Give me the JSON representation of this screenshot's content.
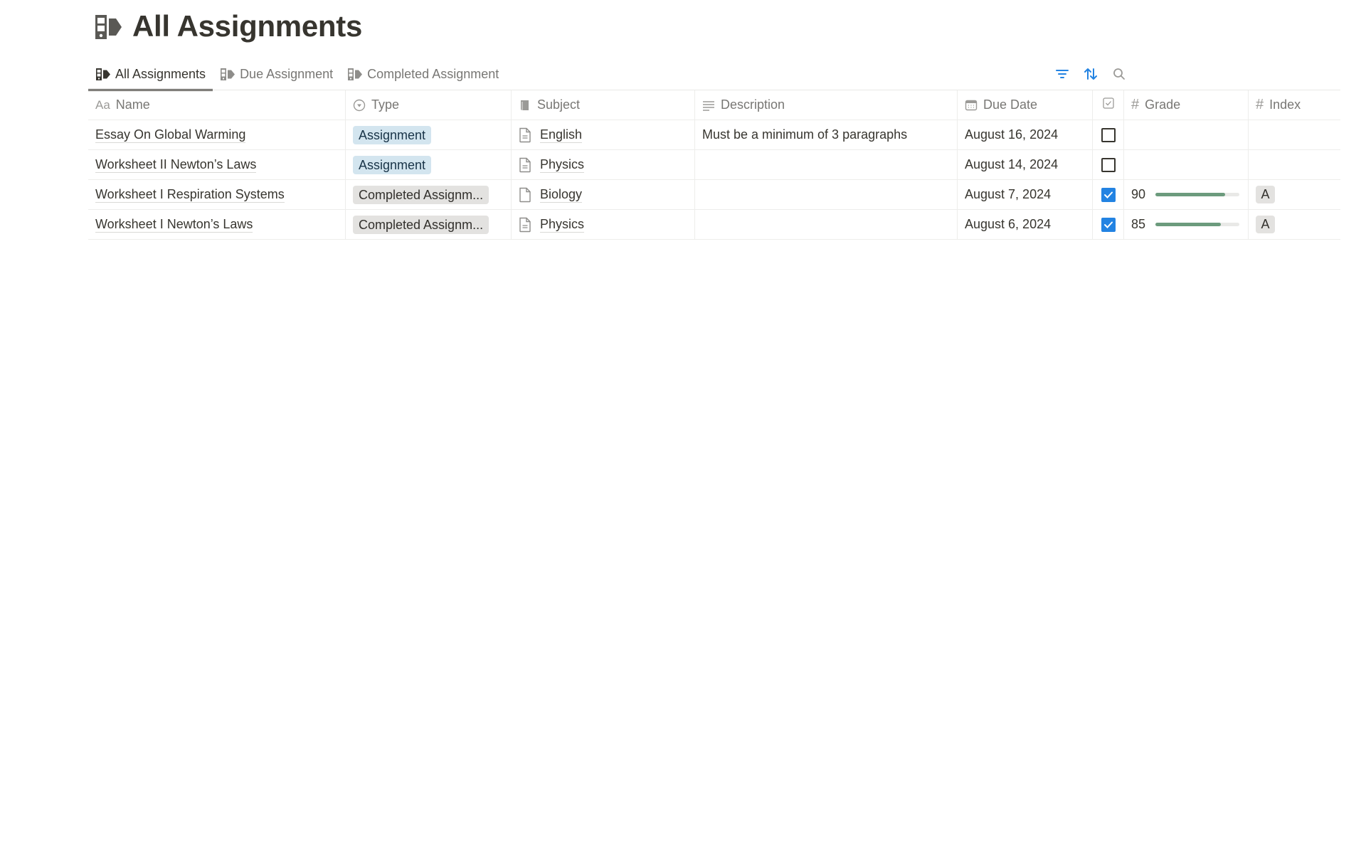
{
  "page": {
    "title": "All Assignments",
    "icon": "assignment-icon"
  },
  "tabs": [
    {
      "label": "All Assignments",
      "active": true
    },
    {
      "label": "Due Assignment",
      "active": false
    },
    {
      "label": "Completed Assignment",
      "active": false
    }
  ],
  "toolbar": {
    "filter_icon": "filter-icon",
    "sort_icon": "sort-icon",
    "search_icon": "search-icon",
    "accent": "#2383e2"
  },
  "table": {
    "columns": [
      {
        "key": "name",
        "label": "Name",
        "icon": "text-icon",
        "icon_text": "Aa"
      },
      {
        "key": "type",
        "label": "Type",
        "icon": "select-icon"
      },
      {
        "key": "subject",
        "label": "Subject",
        "icon": "relation-icon"
      },
      {
        "key": "description",
        "label": "Description",
        "icon": "text-lines-icon"
      },
      {
        "key": "due_date",
        "label": "Due Date",
        "icon": "calendar-icon"
      },
      {
        "key": "done",
        "label": "",
        "icon": "checkbox-icon"
      },
      {
        "key": "grade",
        "label": "Grade",
        "icon": "number-icon"
      },
      {
        "key": "index",
        "label": "Index",
        "icon": "number-icon"
      }
    ],
    "rows": [
      {
        "name": "Essay On Global Warming",
        "type": "Assignment",
        "type_color": "blue",
        "subject": "English",
        "description": "Must be a minimum of 3 paragraphs",
        "due_date": "August 16, 2024",
        "done": false,
        "grade": "",
        "grade_percent": null,
        "index": ""
      },
      {
        "name": "Worksheet II Newton’s Laws",
        "type": "Assignment",
        "type_color": "blue",
        "subject": "Physics",
        "description": "",
        "due_date": "August 14, 2024",
        "done": false,
        "grade": "",
        "grade_percent": null,
        "index": ""
      },
      {
        "name": "Worksheet I Respiration Systems",
        "type": "Completed Assignm...",
        "type_color": "gray",
        "subject": "Biology",
        "description": "",
        "due_date": "August 7, 2024",
        "done": true,
        "grade": "90",
        "grade_percent": 90,
        "index": "A"
      },
      {
        "name": "Worksheet I Newton’s Laws",
        "type": "Completed Assignm...",
        "type_color": "gray",
        "subject": "Physics",
        "description": "",
        "due_date": "August 6, 2024",
        "done": true,
        "grade": "85",
        "grade_percent": 85,
        "index": "A"
      }
    ]
  },
  "colors": {
    "check_blue": "#2383e2",
    "progress_green": "#6c9b7d",
    "tag_blue_bg": "#d3e5ef",
    "tag_gray_bg": "#e3e2e0"
  }
}
